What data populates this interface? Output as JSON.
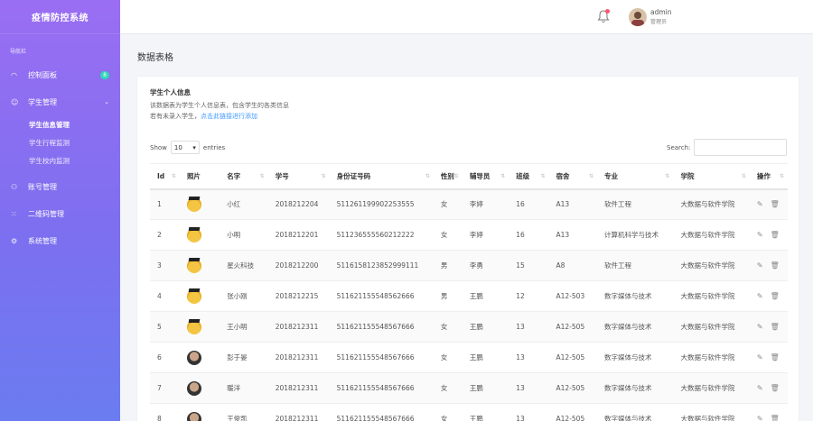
{
  "app": {
    "title": "疫情防控系统"
  },
  "sidebar": {
    "caption": "导航栏",
    "items": [
      {
        "label": "控制面板",
        "icon": "dashboard-icon",
        "badge": "8"
      },
      {
        "label": "学生管理",
        "icon": "user-icon",
        "expanded": true,
        "sub": [
          {
            "label": "学生信息管理"
          },
          {
            "label": "学生行程监测"
          },
          {
            "label": "学生校内监测"
          }
        ]
      },
      {
        "label": "账号管理",
        "icon": "account-icon"
      },
      {
        "label": "二维码管理",
        "icon": "qrcode-icon"
      },
      {
        "label": "系统管理",
        "icon": "gear-icon"
      }
    ]
  },
  "header": {
    "user": "admin",
    "role": "管理员"
  },
  "page": {
    "title": "数据表格"
  },
  "card": {
    "title": "学生个人信息",
    "desc1": "该数据表为学生个人信息表，包含学生的各类信息",
    "desc2": "若有未录入学生，",
    "link": "点击此链接进行添加"
  },
  "table_controls": {
    "show": "Show",
    "entries": "entries",
    "page_size": "10",
    "search": "Search:"
  },
  "table": {
    "headers": [
      "Id",
      "照片",
      "名字",
      "学号",
      "身份证号码",
      "性别",
      "辅导员",
      "班级",
      "宿舍",
      "专业",
      "学院",
      "操作"
    ],
    "rows": [
      {
        "id": "1",
        "photo": "cap",
        "name": "小红",
        "sid": "2018212204",
        "idno": "511261199902253555",
        "sex": "女",
        "tutor": "李婷",
        "cls": "16",
        "dorm": "A13",
        "major": "软件工程",
        "college": "大数据与软件学院"
      },
      {
        "id": "2",
        "photo": "cap",
        "name": "小明",
        "sid": "2018212201",
        "idno": "511236555560212222",
        "sex": "女",
        "tutor": "李婷",
        "cls": "16",
        "dorm": "A13",
        "major": "计算机科学与技术",
        "college": "大数据与软件学院"
      },
      {
        "id": "3",
        "photo": "cap",
        "name": "星火科技",
        "sid": "2018212200",
        "idno": "5116158123852999111",
        "sex": "男",
        "tutor": "李勇",
        "cls": "15",
        "dorm": "A8",
        "major": "软件工程",
        "college": "大数据与软件学院"
      },
      {
        "id": "4",
        "photo": "cap",
        "name": "张小刚",
        "sid": "2018212215",
        "idno": "511621155548562666",
        "sex": "男",
        "tutor": "王鹏",
        "cls": "12",
        "dorm": "A12-503",
        "major": "数字媒体与技术",
        "college": "大数据与软件学院"
      },
      {
        "id": "5",
        "photo": "cap",
        "name": "王小明",
        "sid": "2018212311",
        "idno": "511621155548567666",
        "sex": "女",
        "tutor": "王鹏",
        "cls": "13",
        "dorm": "A12-505",
        "major": "数字媒体与技术",
        "college": "大数据与软件学院"
      },
      {
        "id": "6",
        "photo": "man",
        "name": "彭于晏",
        "sid": "2018212311",
        "idno": "511621155548567666",
        "sex": "女",
        "tutor": "王鹏",
        "cls": "13",
        "dorm": "A12-505",
        "major": "数字媒体与技术",
        "college": "大数据与软件学院"
      },
      {
        "id": "7",
        "photo": "man",
        "name": "暖洋",
        "sid": "2018212311",
        "idno": "511621155548567666",
        "sex": "女",
        "tutor": "王鹏",
        "cls": "13",
        "dorm": "A12-505",
        "major": "数字媒体与技术",
        "college": "大数据与软件学院"
      },
      {
        "id": "8",
        "photo": "man",
        "name": "王俊凯",
        "sid": "2018212311",
        "idno": "511621155548567666",
        "sex": "女",
        "tutor": "王鹏",
        "cls": "13",
        "dorm": "A12-505",
        "major": "数字媒体与技术",
        "college": "大数据与软件学院"
      }
    ]
  }
}
